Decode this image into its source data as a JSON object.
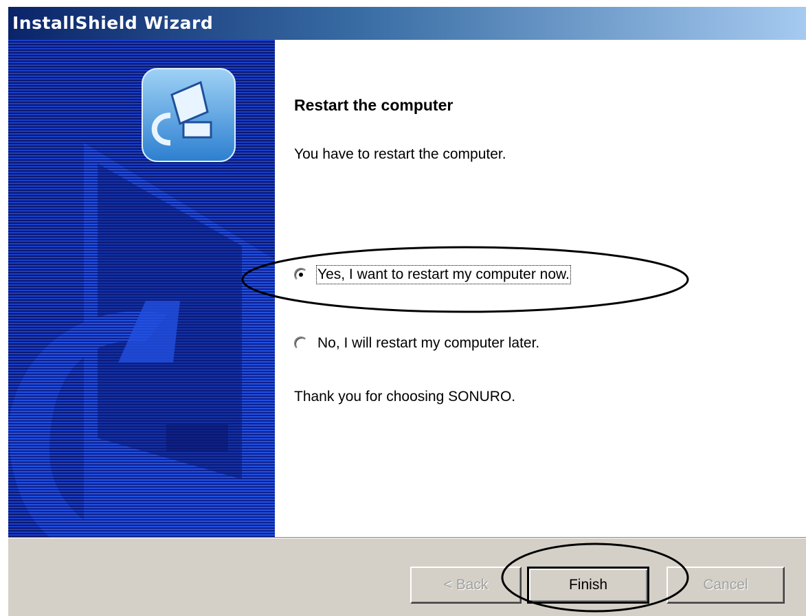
{
  "window": {
    "title": "InstallShield Wizard"
  },
  "main": {
    "heading": "Restart the computer",
    "description": "You have to restart the computer.",
    "options": [
      {
        "label": "Yes, I want to restart my computer now.",
        "selected": true
      },
      {
        "label": "No, I will restart my computer later.",
        "selected": false
      }
    ],
    "thanks": "Thank you for choosing SONURO."
  },
  "buttons": {
    "back": "< Back",
    "finish": "Finish",
    "cancel": "Cancel"
  },
  "colors": {
    "title_gradient_start": "#0a246a",
    "title_gradient_end": "#a6caf0",
    "side_panel": "#0b1a7a",
    "dialog_face": "#d4d0c8"
  }
}
